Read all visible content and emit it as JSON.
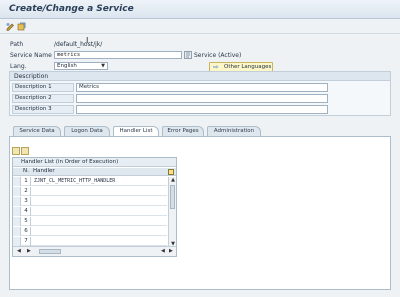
{
  "window": {
    "title": "Create/Change a Service"
  },
  "toolbar": {
    "icons": [
      "display-change-icon",
      "other-object-icon"
    ]
  },
  "form": {
    "path_label": "Path",
    "path_value": "/default_host/jk/",
    "service_name_label": "Service Name",
    "service_name_value": "metrics",
    "service_status": "Service (Active)",
    "lang_label": "Lang.",
    "lang_value": "English",
    "other_languages_label": "Other Languages"
  },
  "description": {
    "group_title": "Description",
    "rows": [
      {
        "label": "Description 1",
        "value": "Metrics"
      },
      {
        "label": "Description 2",
        "value": ""
      },
      {
        "label": "Description 3",
        "value": ""
      }
    ]
  },
  "tabs": [
    {
      "label": "Service Data",
      "active": false
    },
    {
      "label": "Logon Data",
      "active": false
    },
    {
      "label": "Handler List",
      "active": true
    },
    {
      "label": "Error Pages",
      "active": false
    },
    {
      "label": "Administration",
      "active": false
    }
  ],
  "handler_table": {
    "title": "Handler List (in Order of Execution)",
    "col_n": "N.",
    "col_handler": "Handler",
    "rows": [
      {
        "n": "1",
        "handler": "ZJNT_CL_METRIC_HTTP_HANDLER"
      },
      {
        "n": "2",
        "handler": ""
      },
      {
        "n": "3",
        "handler": ""
      },
      {
        "n": "4",
        "handler": ""
      },
      {
        "n": "5",
        "handler": ""
      },
      {
        "n": "6",
        "handler": ""
      },
      {
        "n": "7",
        "handler": ""
      }
    ]
  }
}
